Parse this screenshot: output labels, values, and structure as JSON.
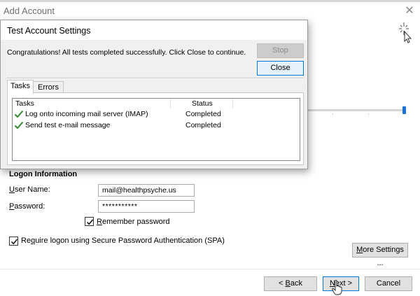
{
  "add_account": {
    "title": "Add Account",
    "close_glyph": "✕"
  },
  "logon": {
    "heading": "Logon Information",
    "user_name_label_ul": "U",
    "user_name_label_rest": "ser Name:",
    "user_name_value": "mail@healthpsyche.us",
    "password_label_ul": "P",
    "password_label_rest": "assword:",
    "password_value": "***********",
    "remember_ul": "R",
    "remember_rest": "emember password",
    "spa_pre": "Re",
    "spa_ul": "q",
    "spa_rest": "uire logon using Secure Password Authentication (SPA)"
  },
  "buttons": {
    "more_settings_ul": "M",
    "more_settings_rest": "ore Settings ...",
    "back_pre": "< ",
    "back_ul": "B",
    "back_rest": "ack",
    "next_ul": "N",
    "next_rest": "ext >",
    "cancel": "Cancel"
  },
  "test_dialog": {
    "title": "Test Account Settings",
    "message": "Congratulations! All tests completed successfully. Click Close to continue.",
    "stop_label": "Stop",
    "close_label": "Close",
    "tabs": [
      {
        "label": "Tasks",
        "active": true
      },
      {
        "label": "Errors",
        "active": false
      }
    ],
    "columns": {
      "tasks": "Tasks",
      "status": "Status"
    },
    "rows": [
      {
        "task": "Log onto incoming mail server (IMAP)",
        "status": "Completed",
        "icon": "green-checkmark-icon"
      },
      {
        "task": "Send test e-mail message",
        "status": "Completed",
        "icon": "green-checkmark-icon"
      }
    ]
  },
  "colors": {
    "check_green": "#2e8b2e",
    "accent_blue": "#0078d7",
    "slider_blue": "#1e6fd6"
  }
}
